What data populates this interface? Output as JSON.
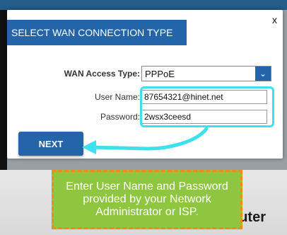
{
  "dialog": {
    "close_label": "x",
    "title": "SELECT WAN CONNECTION TYPE",
    "wan_access_type": {
      "label": "WAN Access Type:",
      "value": "PPPoE"
    },
    "user_name": {
      "label": "User Name:",
      "value": "87654321@hinet.net"
    },
    "password": {
      "label": "Password:",
      "value": "2wsx3ceesd"
    },
    "next_label": "NEXT"
  },
  "callout": {
    "text": "Enter User Name and Password provided by your Network Administrator or ISP."
  },
  "background": {
    "partial_word": "uter"
  },
  "colors": {
    "primary": "#2464a8",
    "highlight": "#3fe0ee",
    "callout_bg": "#8ec63f",
    "callout_border": "#f08a1a"
  }
}
